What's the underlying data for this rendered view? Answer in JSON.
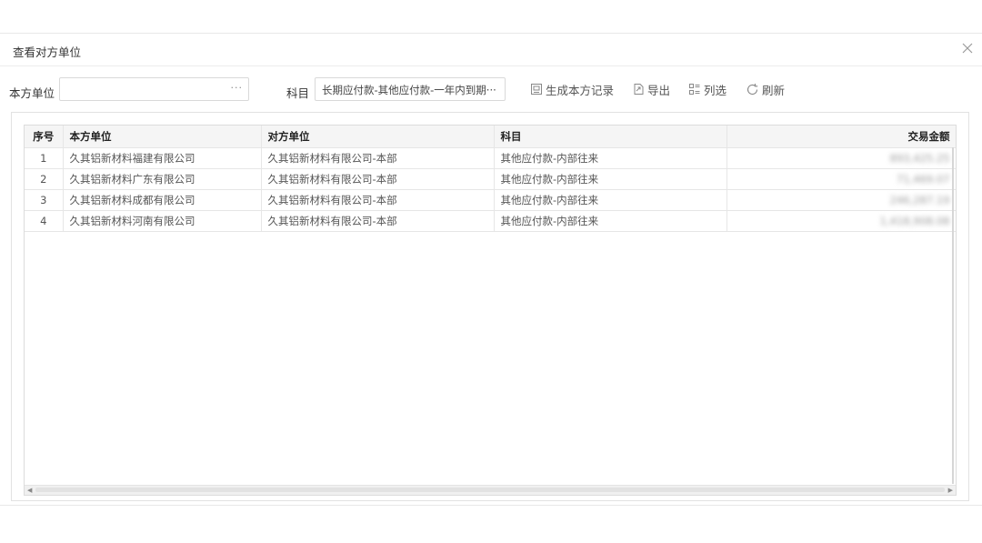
{
  "dialog": {
    "title": "查看对方单位"
  },
  "toolbar": {
    "unit_label": "本方单位",
    "unit_value": "",
    "unit_dots": "···",
    "subject_label": "科目",
    "subject_value": "长期应付款-其他应付款-一年内到期···",
    "generate_label": "生成本方记录",
    "export_label": "导出",
    "columns_label": "列选",
    "refresh_label": "刷新"
  },
  "table": {
    "headers": [
      "序号",
      "本方单位",
      "对方单位",
      "科目",
      "交易金额"
    ],
    "rows": [
      [
        "1",
        "久其铝新材料福建有限公司",
        "久其铝新材料有限公司-本部",
        "其他应付款-内部往来",
        "893,425.25"
      ],
      [
        "2",
        "久其铝新材料广东有限公司",
        "久其铝新材料有限公司-本部",
        "其他应付款-内部往来",
        "71,469.07"
      ],
      [
        "3",
        "久其铝新材料成都有限公司",
        "久其铝新材料有限公司-本部",
        "其他应付款-内部往来",
        "246,287.19"
      ],
      [
        "4",
        "久其铝新材料河南有限公司",
        "久其铝新材料有限公司-本部",
        "其他应付款-内部往来",
        "1,418,908.08"
      ]
    ]
  }
}
